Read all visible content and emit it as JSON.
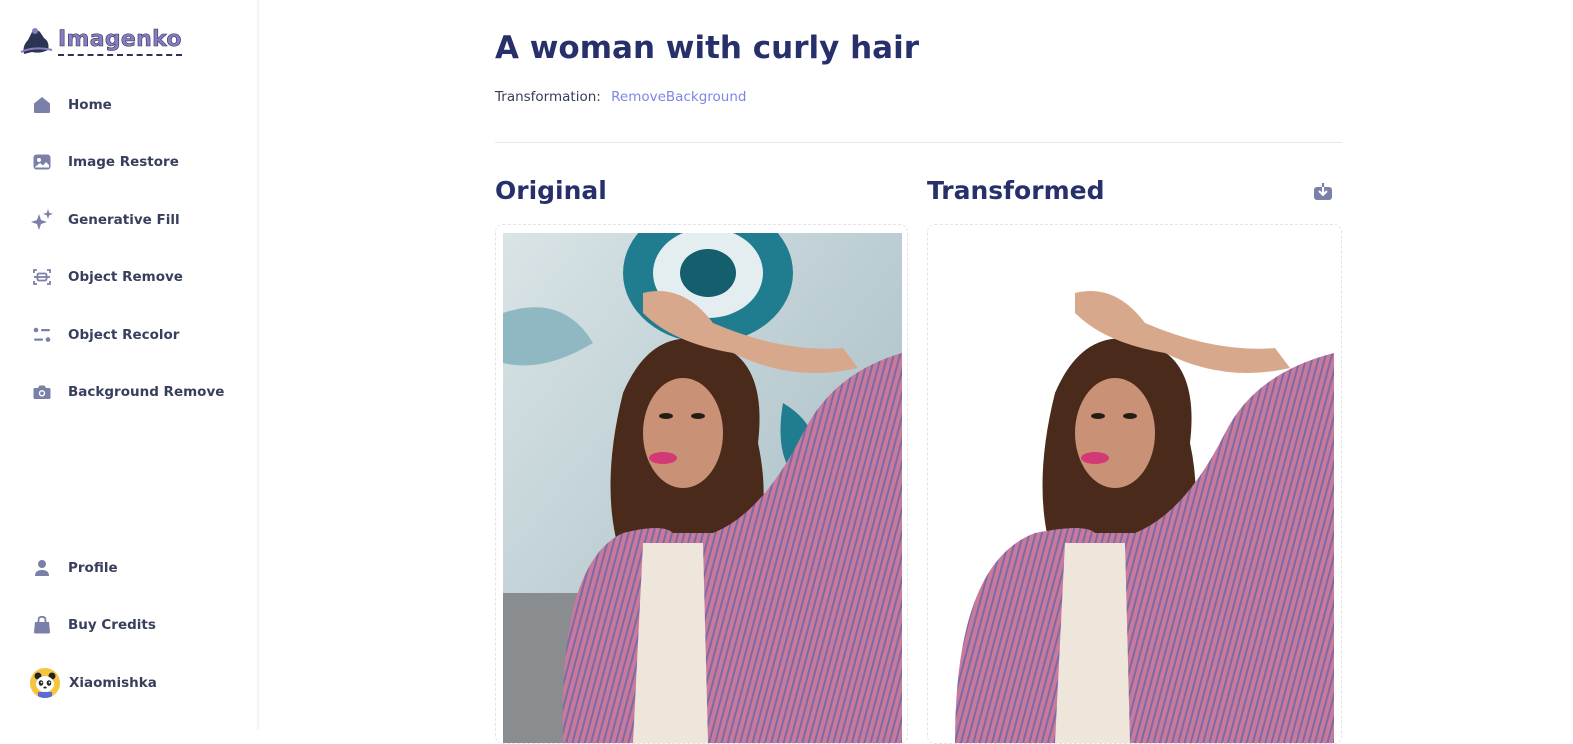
{
  "app": {
    "name": "Imagenko"
  },
  "sidebar": {
    "top_items": [
      {
        "label": "Home",
        "icon": "home-icon"
      },
      {
        "label": "Image Restore",
        "icon": "image-icon"
      },
      {
        "label": "Generative Fill",
        "icon": "sparkles-icon"
      },
      {
        "label": "Object Remove",
        "icon": "scan-icon"
      },
      {
        "label": "Object Recolor",
        "icon": "filter-icon"
      },
      {
        "label": "Background Remove",
        "icon": "camera-icon"
      }
    ],
    "bottom_items": [
      {
        "label": "Profile",
        "icon": "user-icon"
      },
      {
        "label": "Buy Credits",
        "icon": "bag-icon"
      }
    ],
    "user": {
      "name": "Xiaomishka",
      "avatar": "panda-avatar"
    }
  },
  "page": {
    "title": "A woman with curly hair",
    "transformation_label": "Transformation:",
    "transformation_value": "RemoveBackground",
    "original_heading": "Original",
    "transformed_heading": "Transformed"
  },
  "colors": {
    "accent": "#7b86e6",
    "heading": "#28306b",
    "icon": "#7a80a8"
  }
}
